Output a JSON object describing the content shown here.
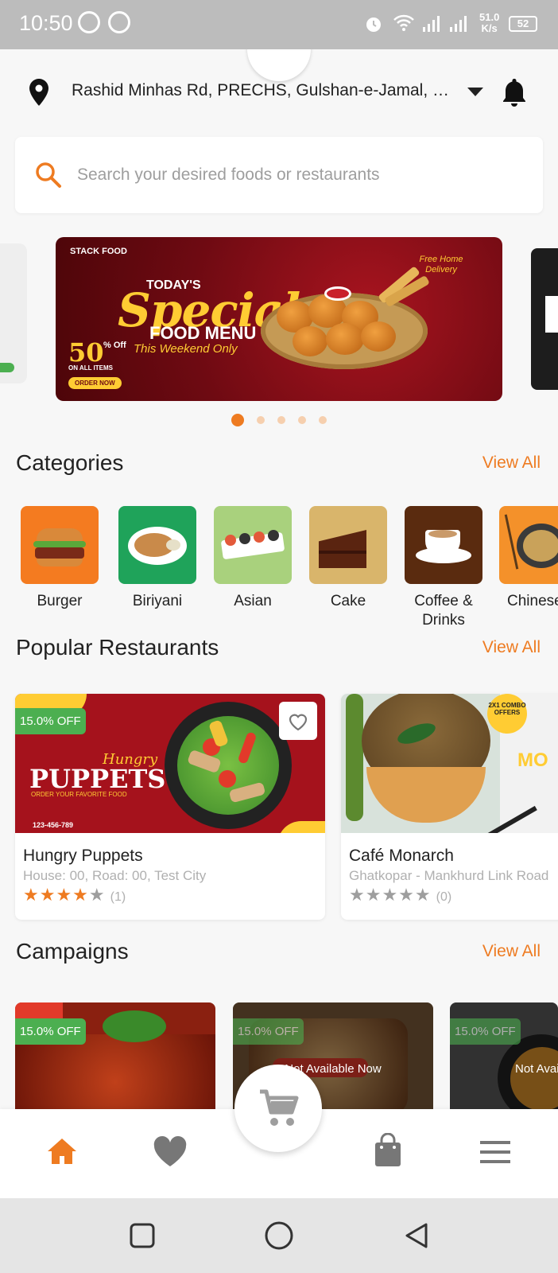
{
  "status_bar": {
    "time": "10:50",
    "network_speed": "51.0",
    "network_unit": "K/s",
    "battery": "52"
  },
  "header": {
    "address": "Rashid Minhas Rd, PRECHS, Gulshan-e-Jamal, Karachi, Sindh, Pakistan"
  },
  "search": {
    "placeholder": "Search your desired foods or restaurants"
  },
  "banner": {
    "brand": "STACK FOOD",
    "today": "TODAY'S",
    "special": "Special",
    "menu": "FOOD MENU",
    "weekend": "This Weekend Only",
    "discount": "50",
    "off": "% Off",
    "on_all": "ON ALL ITEMS",
    "order": "ORDER NOW",
    "delivery": "Free Home Delivery",
    "active_index": 0,
    "count": 5
  },
  "categories": {
    "title": "Categories",
    "view_all": "View All",
    "items": [
      {
        "label": "Burger",
        "color": "#f47b20"
      },
      {
        "label": "Biriyani",
        "color": "#1fa35a"
      },
      {
        "label": "Asian",
        "color": "#a9d17d"
      },
      {
        "label": "Cake",
        "color": "#d9b56b"
      },
      {
        "label": "Coffee & Drinks",
        "color": "#5a2b0f"
      },
      {
        "label": "Chinese",
        "color": "#f4912a"
      }
    ]
  },
  "popular": {
    "title": "Popular Restaurants",
    "view_all": "View All",
    "items": [
      {
        "name": "Hungry Puppets",
        "address": "House: 00, Road: 00, Test City",
        "rating": 4,
        "reviews": "(1)",
        "discount": "15.0% OFF",
        "brand": "PUPPETS",
        "brand_top": "Hungry",
        "brand_sub": "ORDER YOUR FAVORITE FOOD",
        "phone": "123-456-789"
      },
      {
        "name": "Café Monarch",
        "address": "Ghatkopar - Mankhurd Link Road",
        "rating": 0,
        "reviews": "(0)",
        "badge": "2X1 COMBO OFFERS",
        "brand_partial": "MO"
      }
    ]
  },
  "campaigns": {
    "title": "Campaigns",
    "view_all": "View All",
    "items": [
      {
        "discount": "15.0% OFF",
        "available": true
      },
      {
        "discount": "15.0% OFF",
        "available": false,
        "status": "Not Available Now"
      },
      {
        "discount": "15.0% OFF",
        "available": false,
        "status": "Not Available Now"
      }
    ]
  },
  "colors": {
    "accent": "#ee7b21",
    "discount_badge": "#4caf50",
    "banner_bg": "#7a0d14"
  },
  "bottom_nav": {
    "items": [
      "home-icon",
      "favorite-icon",
      "cart-icon",
      "orders-icon",
      "menu-icon"
    ],
    "active": "home-icon"
  }
}
